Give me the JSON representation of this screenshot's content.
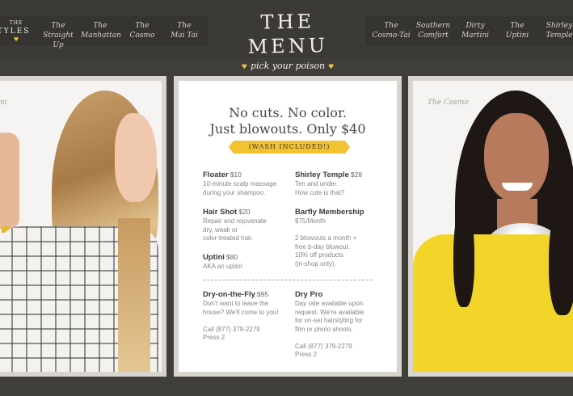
{
  "header": {
    "brand_title": "THE MENU",
    "brand_tagline": "pick your poison",
    "styles_logo": {
      "the": "THE",
      "word": "STYLES"
    },
    "nav_left": [
      {
        "line1": "The",
        "line2": "Straight Up"
      },
      {
        "line1": "The",
        "line2": "Manhattan"
      },
      {
        "line1": "The",
        "line2": "Cosmo"
      },
      {
        "line1": "The",
        "line2": "Mai Tai"
      }
    ],
    "nav_right": [
      {
        "line1": "The",
        "line2": "Cosmo-Tai"
      },
      {
        "line1": "Southern",
        "line2": "Comfort"
      },
      {
        "line1": "Dirty",
        "line2": "Martini"
      },
      {
        "line1": "The",
        "line2": "Uptini"
      },
      {
        "line1": "Shirley",
        "line2": "Temple"
      }
    ]
  },
  "left_photo": {
    "label": "ni"
  },
  "right_photo": {
    "label": "The Cosmo"
  },
  "menu_card": {
    "headline_line1": "No cuts. No color.",
    "headline_line2": "Just blowouts. Only $40",
    "ribbon": "(WASH INCLUDED!)",
    "services": [
      {
        "name": "Floater",
        "price": "$10",
        "desc": "10-minute scalp massage\nduring your shampoo."
      },
      {
        "name": "Shirley Temple",
        "price": "$28",
        "desc": "Ten and under.\nHow cute is that?"
      },
      {
        "name": "Hair Shot",
        "price": "$20",
        "desc": "Repair and rejuvenate\ndry, weak or\ncolor-treated hair."
      },
      {
        "name": "Barfly Membership",
        "price": "",
        "desc": "$75/Month\n\n2 blowouts a month +\nfree b-day blowout.\n10% off products\n(in-shop only)."
      },
      {
        "name": "Uptini",
        "price": "$80",
        "desc": "AKA an updo!"
      },
      {
        "name": "Dry-on-the-Fly",
        "price": "$95",
        "desc": "Don't want to leave the\nhouse? We'll come to you!\n\nCall (877) 379-2279\nPress 2"
      },
      {
        "name": "Dry Pro",
        "price": "",
        "desc": "Day rate available upon\nrequest. We're available\nfor on-set hairstyling for\nfilm or photo shoots.\n\nCall (877) 379-2279\nPress 2"
      }
    ]
  },
  "colors": {
    "background": "#403e3b",
    "accent_yellow": "#f2c230",
    "card": "#ffffff"
  },
  "icons": [
    "heart-icon"
  ]
}
